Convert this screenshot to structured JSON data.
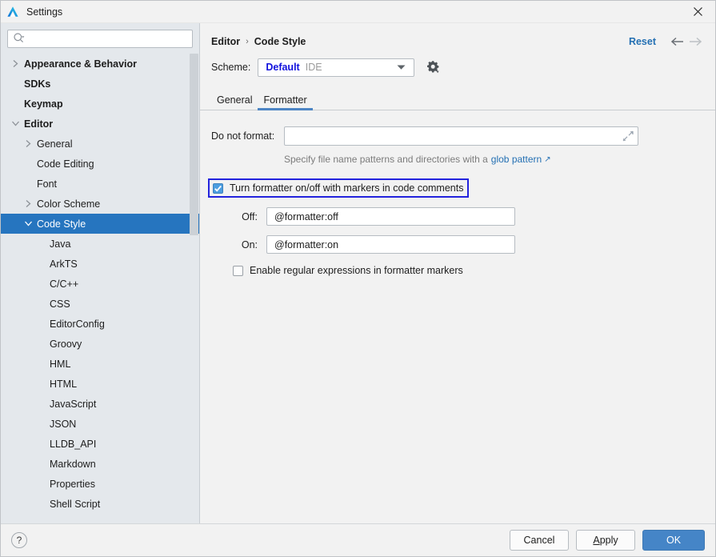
{
  "window": {
    "title": "Settings",
    "app_icon": "deveco-logo-icon",
    "close_icon": "close-icon",
    "accent_blue": "#2675bf",
    "link_blue": "#2470b3",
    "highlight_border": "#2323dd"
  },
  "search": {
    "value": "",
    "placeholder": "",
    "icon": "search-icon"
  },
  "sidebar": {
    "items": [
      {
        "label": "Appearance & Behavior",
        "level": 0,
        "bold": true,
        "arrow": "right",
        "selected": false
      },
      {
        "label": "SDKs",
        "level": 0,
        "bold": true,
        "arrow": "none",
        "selected": false
      },
      {
        "label": "Keymap",
        "level": 0,
        "bold": true,
        "arrow": "none",
        "selected": false
      },
      {
        "label": "Editor",
        "level": 0,
        "bold": true,
        "arrow": "down",
        "selected": false
      },
      {
        "label": "General",
        "level": 1,
        "bold": false,
        "arrow": "right",
        "selected": false
      },
      {
        "label": "Code Editing",
        "level": 1,
        "bold": false,
        "arrow": "none",
        "selected": false
      },
      {
        "label": "Font",
        "level": 1,
        "bold": false,
        "arrow": "none",
        "selected": false
      },
      {
        "label": "Color Scheme",
        "level": 1,
        "bold": false,
        "arrow": "right",
        "selected": false
      },
      {
        "label": "Code Style",
        "level": 1,
        "bold": false,
        "arrow": "down",
        "selected": true
      },
      {
        "label": "Java",
        "level": 2,
        "bold": false,
        "arrow": "none",
        "selected": false
      },
      {
        "label": "ArkTS",
        "level": 2,
        "bold": false,
        "arrow": "none",
        "selected": false
      },
      {
        "label": "C/C++",
        "level": 2,
        "bold": false,
        "arrow": "none",
        "selected": false
      },
      {
        "label": "CSS",
        "level": 2,
        "bold": false,
        "arrow": "none",
        "selected": false
      },
      {
        "label": "EditorConfig",
        "level": 2,
        "bold": false,
        "arrow": "none",
        "selected": false
      },
      {
        "label": "Groovy",
        "level": 2,
        "bold": false,
        "arrow": "none",
        "selected": false
      },
      {
        "label": "HML",
        "level": 2,
        "bold": false,
        "arrow": "none",
        "selected": false
      },
      {
        "label": "HTML",
        "level": 2,
        "bold": false,
        "arrow": "none",
        "selected": false
      },
      {
        "label": "JavaScript",
        "level": 2,
        "bold": false,
        "arrow": "none",
        "selected": false
      },
      {
        "label": "JSON",
        "level": 2,
        "bold": false,
        "arrow": "none",
        "selected": false
      },
      {
        "label": "LLDB_API",
        "level": 2,
        "bold": false,
        "arrow": "none",
        "selected": false
      },
      {
        "label": "Markdown",
        "level": 2,
        "bold": false,
        "arrow": "none",
        "selected": false
      },
      {
        "label": "Properties",
        "level": 2,
        "bold": false,
        "arrow": "none",
        "selected": false
      },
      {
        "label": "Shell Script",
        "level": 2,
        "bold": false,
        "arrow": "none",
        "selected": false
      }
    ]
  },
  "header": {
    "breadcrumb": [
      "Editor",
      "Code Style"
    ],
    "separator": "›",
    "reset_label": "Reset",
    "back_icon": "arrow-left-icon",
    "forward_icon": "arrow-right-icon"
  },
  "scheme": {
    "label": "Scheme:",
    "name": "Default",
    "kind": "IDE",
    "caret_icon": "chevron-down-icon",
    "gear_icon": "gear-icon"
  },
  "tabs": [
    {
      "label": "General",
      "active": false
    },
    {
      "label": "Formatter",
      "active": true
    }
  ],
  "form": {
    "do_not_format": {
      "label": "Do not format:",
      "value": "",
      "placeholder": "",
      "expand_icon": "expand-icon"
    },
    "hint": {
      "text": "Specify file name patterns and directories with a",
      "link": "glob pattern",
      "link_icon": "external-link-icon"
    },
    "markers_checkbox": {
      "label": "Turn formatter on/off with markers in code comments",
      "checked": true,
      "highlighted": true
    },
    "off": {
      "label": "Off:",
      "value": "@formatter:off"
    },
    "on": {
      "label": "On:",
      "value": "@formatter:on"
    },
    "regex_checkbox": {
      "label": "Enable regular expressions in formatter markers",
      "checked": false
    }
  },
  "footer": {
    "help_icon": "help-icon",
    "help_glyph": "?",
    "cancel_label": "Cancel",
    "apply_label": "Apply",
    "apply_mnemonic": "A",
    "apply_rest": "pply",
    "ok_label": "OK"
  }
}
